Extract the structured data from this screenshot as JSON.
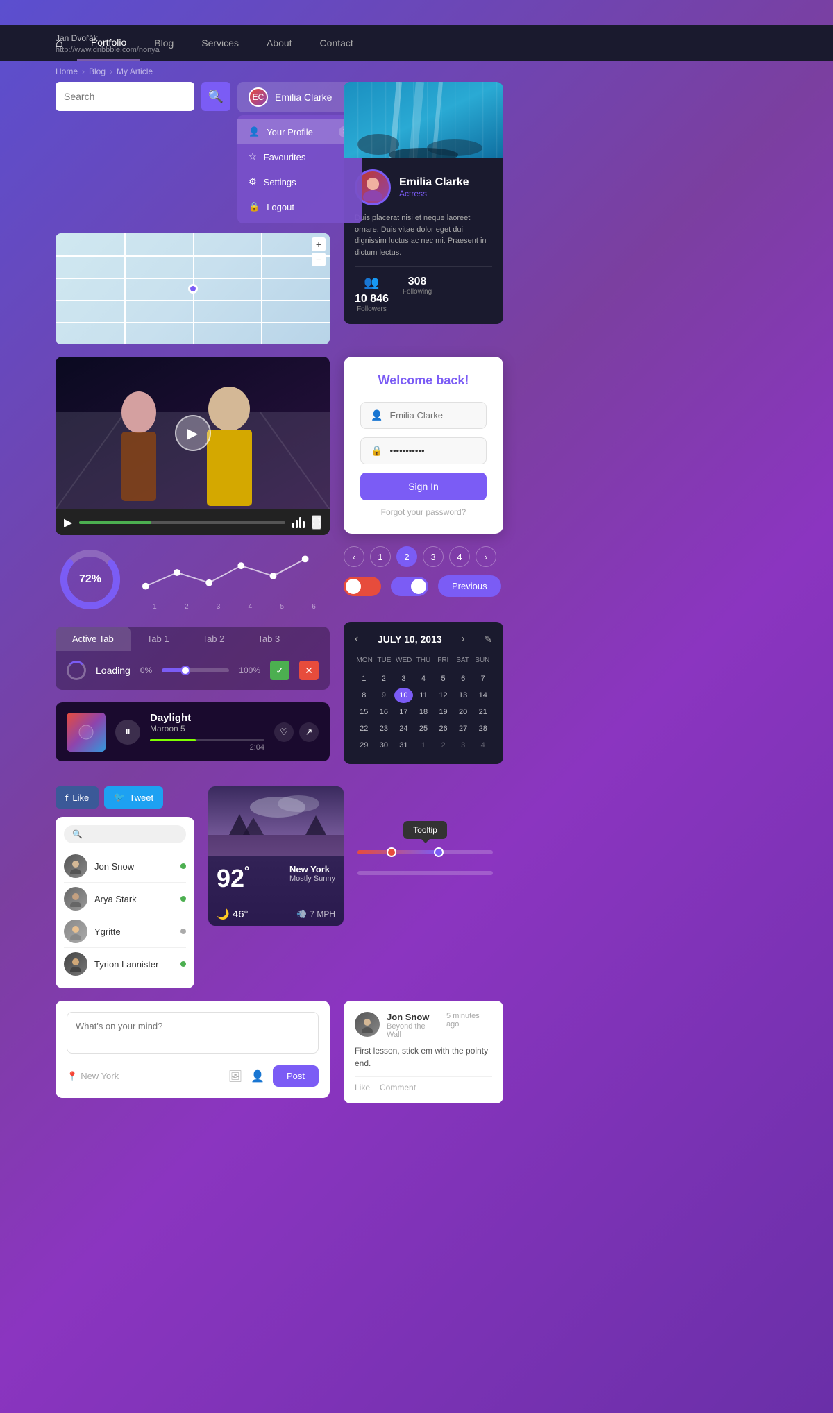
{
  "watermark": {
    "name": "Jan Dvořák",
    "url": "http://www.dribbble.com/nonya"
  },
  "nav": {
    "home_icon": "⌂",
    "links": [
      "Portfolio",
      "Blog",
      "Services",
      "About",
      "Contact"
    ],
    "active_index": 0
  },
  "breadcrumb": {
    "items": [
      "Home",
      "Blog",
      "My Article"
    ]
  },
  "search": {
    "placeholder": "Search",
    "icon": "🔍"
  },
  "user_dropdown": {
    "name": "Emilia Clarke",
    "items": [
      {
        "label": "Your Profile",
        "icon": "👤"
      },
      {
        "label": "Favourites",
        "icon": "☆"
      },
      {
        "label": "Settings",
        "icon": "⚙"
      },
      {
        "label": "Logout",
        "icon": "🔒"
      }
    ]
  },
  "profile_card": {
    "name": "Emilia Clarke",
    "title": "Actress",
    "bio": "Duis placerat nisi et neque laoreet ornare. Duis vitae dolor eget dui dignissim luctus ac nec mi. Praesent in dictum lectus.",
    "followers": "10 846",
    "following": "308",
    "followers_label": "Followers",
    "following_label": "Following"
  },
  "donut": {
    "percent": "72%",
    "percent_num": 72
  },
  "line_chart": {
    "labels": [
      "1",
      "2",
      "3",
      "4",
      "5",
      "6"
    ]
  },
  "tabs": {
    "items": [
      "Active Tab",
      "Tab 1",
      "Tab 2",
      "Tab 3"
    ],
    "active": 0
  },
  "loading": {
    "text": "Loading",
    "pct_start": "0%",
    "pct_end": "100%"
  },
  "music": {
    "title": "Daylight",
    "artist": "Maroon 5",
    "time": "2:04"
  },
  "pagination": {
    "pages": [
      "<",
      "1",
      "2",
      "3",
      "4",
      ">"
    ],
    "active": 2
  },
  "prev_button": {
    "label": "Previous"
  },
  "social": {
    "like": "Like",
    "tweet": "Tweet"
  },
  "user_list": {
    "users": [
      {
        "name": "Jon Snow",
        "status": "online"
      },
      {
        "name": "Arya Stark",
        "status": "online"
      },
      {
        "name": "Ygritte",
        "status": "offline"
      },
      {
        "name": "Tyrion Lannister",
        "status": "online"
      }
    ]
  },
  "weather": {
    "temp": "92",
    "unit": "°",
    "city": "New York",
    "condition": "Mostly Sunny",
    "low": "46°",
    "wind": "7 MPH"
  },
  "tooltip": {
    "text": "Tooltip"
  },
  "calendar": {
    "title": "JULY 10, 2013",
    "day_labels": [
      "MON",
      "TUE",
      "WED",
      "THU",
      "FRI",
      "SAT",
      "SUN"
    ],
    "days": [
      {
        "day": "1",
        "type": "normal"
      },
      {
        "day": "2",
        "type": "normal"
      },
      {
        "day": "3",
        "type": "normal"
      },
      {
        "day": "4",
        "type": "normal"
      },
      {
        "day": "5",
        "type": "normal"
      },
      {
        "day": "6",
        "type": "normal"
      },
      {
        "day": "7",
        "type": "normal"
      },
      {
        "day": "8",
        "type": "normal"
      },
      {
        "day": "9",
        "type": "normal"
      },
      {
        "day": "10",
        "type": "today"
      },
      {
        "day": "11",
        "type": "normal"
      },
      {
        "day": "12",
        "type": "normal"
      },
      {
        "day": "13",
        "type": "normal"
      },
      {
        "day": "14",
        "type": "normal"
      },
      {
        "day": "15",
        "type": "normal"
      },
      {
        "day": "16",
        "type": "normal"
      },
      {
        "day": "17",
        "type": "normal"
      },
      {
        "day": "18",
        "type": "normal"
      },
      {
        "day": "19",
        "type": "normal"
      },
      {
        "day": "20",
        "type": "normal"
      },
      {
        "day": "21",
        "type": "normal"
      },
      {
        "day": "22",
        "type": "normal"
      },
      {
        "day": "23",
        "type": "normal"
      },
      {
        "day": "24",
        "type": "normal"
      },
      {
        "day": "25",
        "type": "normal"
      },
      {
        "day": "26",
        "type": "normal"
      },
      {
        "day": "27",
        "type": "normal"
      },
      {
        "day": "28",
        "type": "normal"
      },
      {
        "day": "29",
        "type": "normal"
      },
      {
        "day": "30",
        "type": "normal"
      },
      {
        "day": "31",
        "type": "normal"
      },
      {
        "day": "1",
        "type": "other-month"
      },
      {
        "day": "2",
        "type": "other-month"
      },
      {
        "day": "3",
        "type": "other-month"
      },
      {
        "day": "4",
        "type": "other-month"
      }
    ]
  },
  "post": {
    "placeholder": "What's on your mind?",
    "location": "New York",
    "btn_label": "Post"
  },
  "comment": {
    "user": "Jon Snow",
    "sub": "Beyond the Wall",
    "time": "5 minutes ago",
    "text": "First lesson, stick em with the pointy end.",
    "like": "Like",
    "comment": "Comment"
  },
  "login": {
    "title": "Welcome back!",
    "username_placeholder": "Emilia Clarke",
    "password_placeholder": "***********",
    "sign_in": "Sign In",
    "forgot": "Forgot your password?"
  }
}
